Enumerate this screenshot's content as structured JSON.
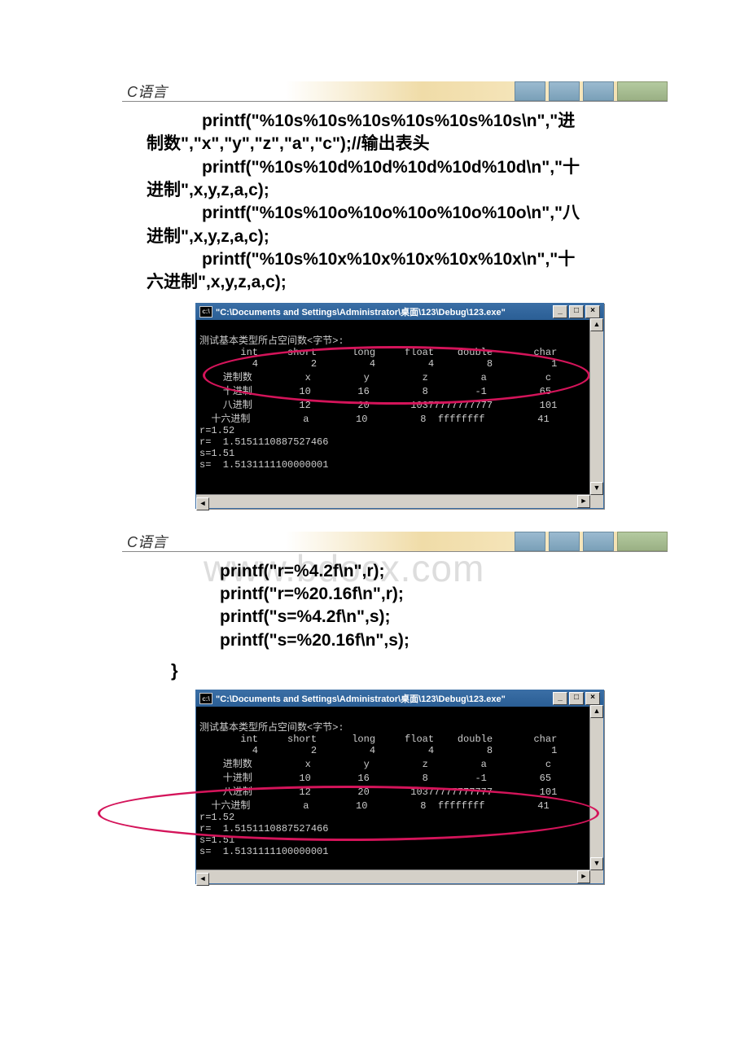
{
  "header": {
    "label": "C语言"
  },
  "code1": {
    "l1a": "printf(\"%10s%10s%10s%10s%10s%10s\\n\",\"进",
    "l1b": "制数\",\"x\",\"y\",\"z\",\"a\",\"c\");",
    "l1c": "//输出表头",
    "l2a": "printf(\"%10s%10d%10d%10d%10d%10d\\n\",\"十",
    "l2b": "进制\",x,y,z,a,c);",
    "l3a": "printf(\"%10s%10o%10o%10o%10o%10o\\n\",\"八",
    "l3b": "进制\",x,y,z,a,c);",
    "l4a": "printf(\"%10s%10x%10x%10x%10x%10x\\n\",\"十",
    "l4b": "六进制\",x,y,z,a,c);"
  },
  "console1": {
    "title": "\"C:\\Documents and Settings\\Administrator\\桌面\\123\\Debug\\123.exe\"",
    "l0": "测试基本类型所占空间数<字节>:",
    "l1": "       int     short      long     float    double       char",
    "l2": "         4         2         4         4         8          1",
    "l3": "    进制数         x         y         z         a          c",
    "l4": "    十进制        10        16         8        -1         65",
    "l5": "    八进制        12        20       10377777777777        101",
    "l6": "  十六进制         a        10         8  ffffffff         41",
    "l7": "r=1.52",
    "l8": "r=  1.5151110887527466",
    "l9": "s=1.51",
    "l10": "s=  1.5131111100000001"
  },
  "watermark": "www.bdocx.com",
  "code2": {
    "l1": "printf(\"r=%4.2f\\n\",r);",
    "l2": "printf(\"r=%20.16f\\n\",r);",
    "l3": "printf(\"s=%4.2f\\n\",s);",
    "l4": "printf(\"s=%20.16f\\n\",s);",
    "brace": "}"
  },
  "console2": {
    "title": "\"C:\\Documents and Settings\\Administrator\\桌面\\123\\Debug\\123.exe\"",
    "l0": "测试基本类型所占空间数<字节>:",
    "l1": "       int     short      long     float    double       char",
    "l2": "         4         2         4         4         8          1",
    "l3": "    进制数         x         y         z         a          c",
    "l4": "    十进制        10        16         8        -1         65",
    "l5": "    八进制        12        20       10377777777777        101",
    "l6": "  十六进制         a        10         8  ffffffff         41",
    "l7": "r=1.52",
    "l8": "r=  1.5151110887527466",
    "l9": "s=1.51",
    "l10": "s=  1.5131111100000001"
  }
}
